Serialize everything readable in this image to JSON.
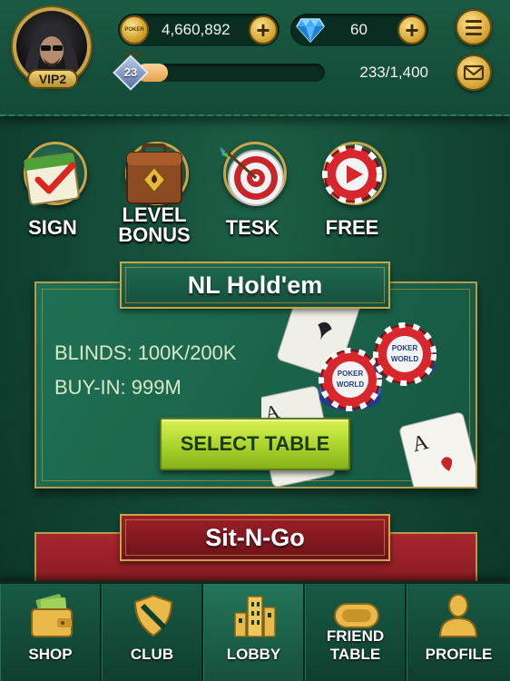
{
  "header": {
    "vip_label": "VIP2",
    "coins": "4,660,892",
    "coin_icon_text": "POKER WORLD",
    "gems": "60",
    "level": "23",
    "xp_text": "233/1,400",
    "xp_progress": 0.166
  },
  "features": [
    {
      "label": "SIGN",
      "icon": "calendar-check-icon"
    },
    {
      "label_line1": "LEVEL",
      "label_line2": "BONUS",
      "icon": "briefcase-icon"
    },
    {
      "label": "TESK",
      "icon": "target-icon"
    },
    {
      "label": "FREE",
      "icon": "chip-play-icon"
    }
  ],
  "game_card": {
    "title": "NL Hold'em",
    "blinds": "BLINDS: 100K/200K",
    "buyin": "BUY-IN: 999M",
    "button": "SELECT TABLE",
    "chip_text_1": "POKER",
    "chip_text_2": "WORLD"
  },
  "second_card": {
    "title": "Sit-N-Go"
  },
  "nav": [
    {
      "label": "SHOP",
      "icon": "wallet-icon"
    },
    {
      "label": "CLUB",
      "icon": "shield-icon"
    },
    {
      "label": "LOBBY",
      "icon": "buildings-icon",
      "active": true
    },
    {
      "label": "FRIEND TABLE",
      "icon": "table-icon"
    },
    {
      "label": "PROFILE",
      "icon": "person-icon"
    }
  ],
  "colors": {
    "gold": "#c9a449",
    "felt_green": "#1a6249",
    "button_green": "#aad32e",
    "sitngo_red": "#a7262e"
  }
}
